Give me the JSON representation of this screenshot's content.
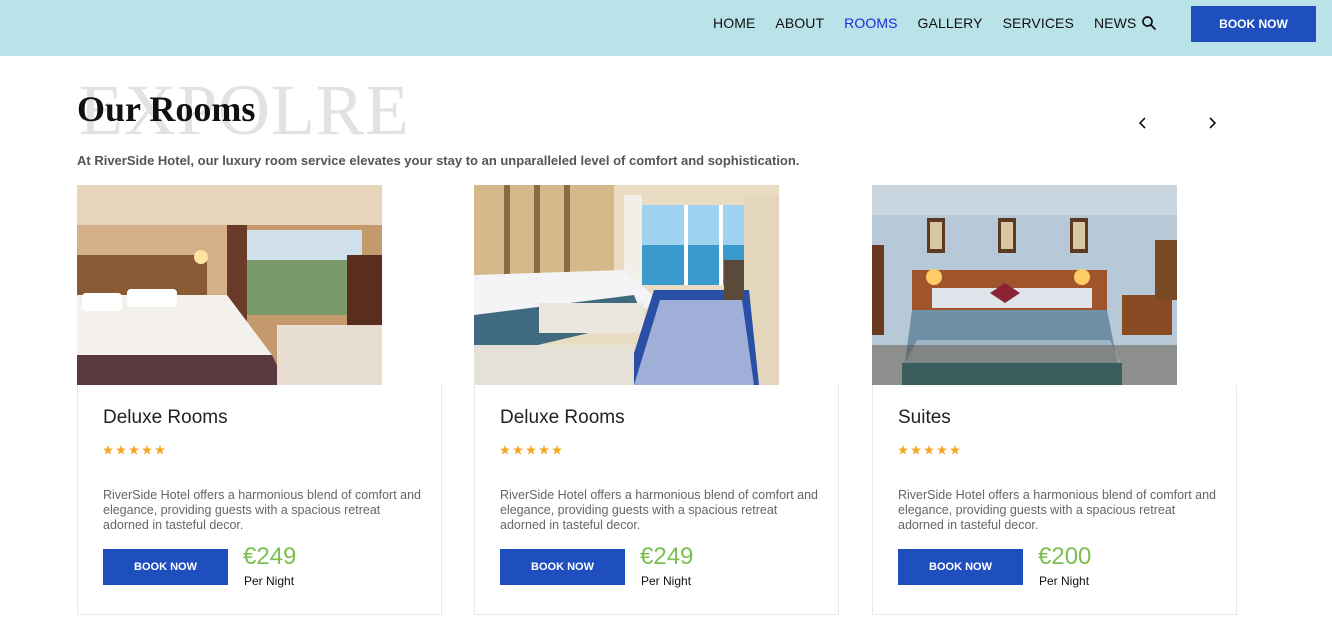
{
  "nav": {
    "items": [
      {
        "label": "HOME"
      },
      {
        "label": "ABOUT"
      },
      {
        "label": "ROOMS"
      },
      {
        "label": "GALLERY"
      },
      {
        "label": "SERVICES"
      },
      {
        "label": "NEWS"
      }
    ],
    "active": "ROOMS",
    "search_icon": "search-icon",
    "book_label": "BOOK NOW"
  },
  "hero": {
    "watermark": "EXPOLRE",
    "title": "Our Rooms",
    "subtitle": "At RiverSide Hotel, our luxury room service elevates your stay to an unparalleled level of comfort and sophistication.",
    "prev_icon": "chevron-left-icon",
    "next_icon": "chevron-right-icon"
  },
  "rooms": [
    {
      "title": "Deluxe Rooms",
      "rating": 5,
      "description": "RiverSide Hotel offers a harmonious blend of comfort and elegance, providing guests with a spacious retreat adorned in tasteful decor.",
      "button": "BOOK NOW",
      "price": "€249",
      "per": "Per Night"
    },
    {
      "title": "Deluxe Rooms",
      "rating": 5,
      "description": "RiverSide Hotel offers a harmonious blend of comfort and elegance, providing guests with a spacious retreat adorned in tasteful decor.",
      "button": "BOOK NOW",
      "price": "€249",
      "per": "Per Night"
    },
    {
      "title": "Suites",
      "rating": 5,
      "description": "RiverSide Hotel offers a harmonious blend of comfort and elegance, providing guests with a spacious retreat adorned in tasteful decor.",
      "button": "BOOK NOW",
      "price": "€200",
      "per": "Per Night"
    }
  ],
  "colors": {
    "header_bg": "#b9e2e9",
    "button": "#1f4fbe",
    "active_nav": "#1d2bd6",
    "price": "#7bbf4f",
    "star": "#f5a623"
  }
}
